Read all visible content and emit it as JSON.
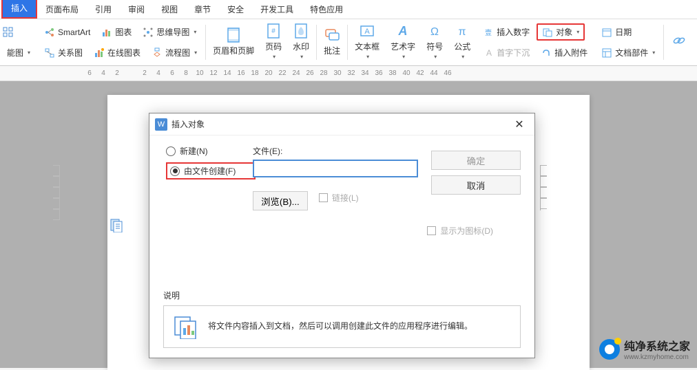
{
  "tabs": {
    "insert": "插入",
    "page_layout": "页面布局",
    "reference": "引用",
    "review": "审阅",
    "view": "视图",
    "chapter": "章节",
    "security": "安全",
    "dev_tools": "开发工具",
    "special": "特色应用"
  },
  "ribbon": {
    "row1": {
      "smartart": "SmartArt",
      "chart": "图表",
      "mindmap": "思维导图"
    },
    "row2": {
      "funcmap": "能图",
      "relation": "关系图",
      "online_chart": "在线图表",
      "flowchart": "流程图"
    },
    "big": {
      "header_footer": "页眉和页脚",
      "page_number": "页码",
      "watermark": "水印",
      "comment": "批注",
      "textbox": "文本框",
      "wordart": "艺术字",
      "symbol": "符号",
      "formula": "公式"
    },
    "right": {
      "insert_number": "插入数字",
      "object": "对象",
      "drop_cap": "首字下沉",
      "attachment": "插入附件",
      "date": "日期",
      "doc_parts": "文档部件",
      "hyperlink": "超链接"
    }
  },
  "ruler": [
    "6",
    "4",
    "2",
    "",
    "2",
    "4",
    "6",
    "8",
    "10",
    "12",
    "14",
    "16",
    "18",
    "20",
    "22",
    "24",
    "26",
    "28",
    "30",
    "32",
    "34",
    "36",
    "38",
    "40",
    "42",
    "44",
    "46"
  ],
  "dialog": {
    "title": "插入对象",
    "radio_new": "新建(N)",
    "radio_file": "由文件创建(F)",
    "file_label": "文件(E):",
    "file_value": "",
    "browse": "浏览(B)...",
    "link": "链接(L)",
    "ok": "确定",
    "cancel": "取消",
    "show_icon": "显示为图标(D)",
    "desc_label": "说明",
    "desc_text": "将文件内容插入到文档，然后可以调用创建此文件的应用程序进行编辑。"
  },
  "watermark": {
    "title": "纯净系统之家",
    "url": "www.kzmyhome.com"
  }
}
